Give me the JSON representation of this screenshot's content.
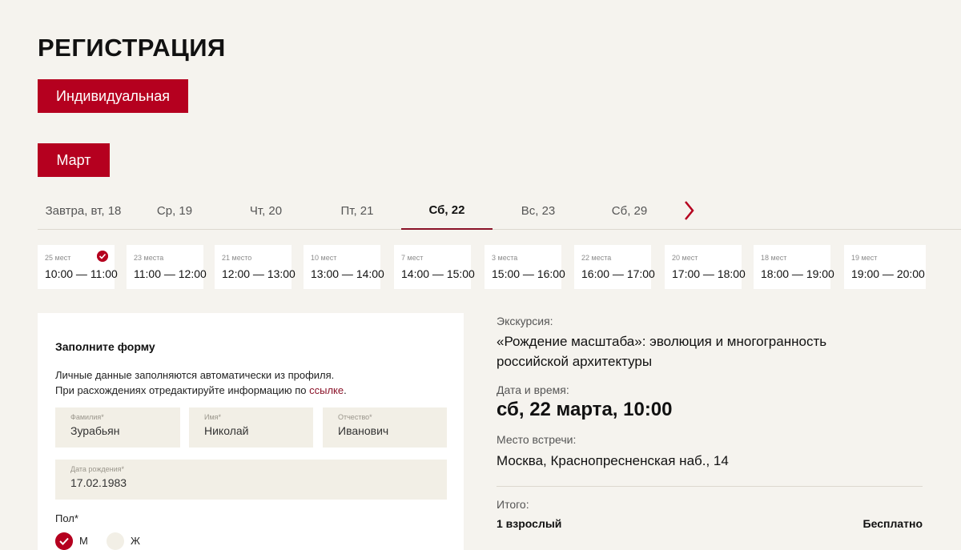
{
  "page": {
    "title": "РЕГИСТРАЦИЯ",
    "type_button": "Индивидуальная",
    "month_button": "Март"
  },
  "dates": [
    {
      "label": "Завтра, вт, 18",
      "active": false
    },
    {
      "label": "Ср, 19",
      "active": false
    },
    {
      "label": "Чт, 20",
      "active": false
    },
    {
      "label": "Пт, 21",
      "active": false
    },
    {
      "label": "Сб, 22",
      "active": true
    },
    {
      "label": "Вс, 23",
      "active": false
    },
    {
      "label": "Сб, 29",
      "active": false
    }
  ],
  "slots": [
    {
      "capacity": "25 мест",
      "time": "10:00 — 11:00",
      "selected": true
    },
    {
      "capacity": "23 места",
      "time": "11:00 — 12:00",
      "selected": false
    },
    {
      "capacity": "21 место",
      "time": "12:00 — 13:00",
      "selected": false
    },
    {
      "capacity": "10 мест",
      "time": "13:00 — 14:00",
      "selected": false
    },
    {
      "capacity": "7 мест",
      "time": "14:00 — 15:00",
      "selected": false
    },
    {
      "capacity": "3 места",
      "time": "15:00 — 16:00",
      "selected": false
    },
    {
      "capacity": "22 места",
      "time": "16:00 — 17:00",
      "selected": false
    },
    {
      "capacity": "20 мест",
      "time": "17:00 — 18:00",
      "selected": false
    },
    {
      "capacity": "18 мест",
      "time": "18:00 — 19:00",
      "selected": false
    },
    {
      "capacity": "19 мест",
      "time": "19:00 — 20:00",
      "selected": false
    }
  ],
  "form": {
    "title": "Заполните форму",
    "note_line1": "Личные данные заполняются автоматически из профиля.",
    "note_line2_prefix": "При расхождениях отредактируйте информацию по ",
    "note_link": "ссылке",
    "note_line2_suffix": ".",
    "surname_label": "Фамилия*",
    "surname_value": "Зурабьян",
    "name_label": "Имя*",
    "name_value": "Николай",
    "patronymic_label": "Отчество*",
    "patronymic_value": "Иванович",
    "birth_label": "Дата рождения*",
    "birth_value": "17.02.1983",
    "gender_label": "Пол*",
    "gender_m": "М",
    "gender_f": "Ж"
  },
  "info": {
    "excursion_label": "Экскурсия:",
    "excursion_line1": "«Рождение масштаба»: эволюция и многогранность",
    "excursion_line2": "российской архитектуры",
    "datetime_label": "Дата и время:",
    "datetime_value": "сб, 22 марта, 10:00",
    "place_label": "Место встречи:",
    "place_value": "Москва, Краснопресненская наб., 14",
    "total_label": "Итого:",
    "total_people": "1 взрослый",
    "total_price": "Бесплатно"
  },
  "colors": {
    "accent": "#b5001f",
    "background": "#f5f3ee",
    "field_bg": "#f2efe6"
  }
}
